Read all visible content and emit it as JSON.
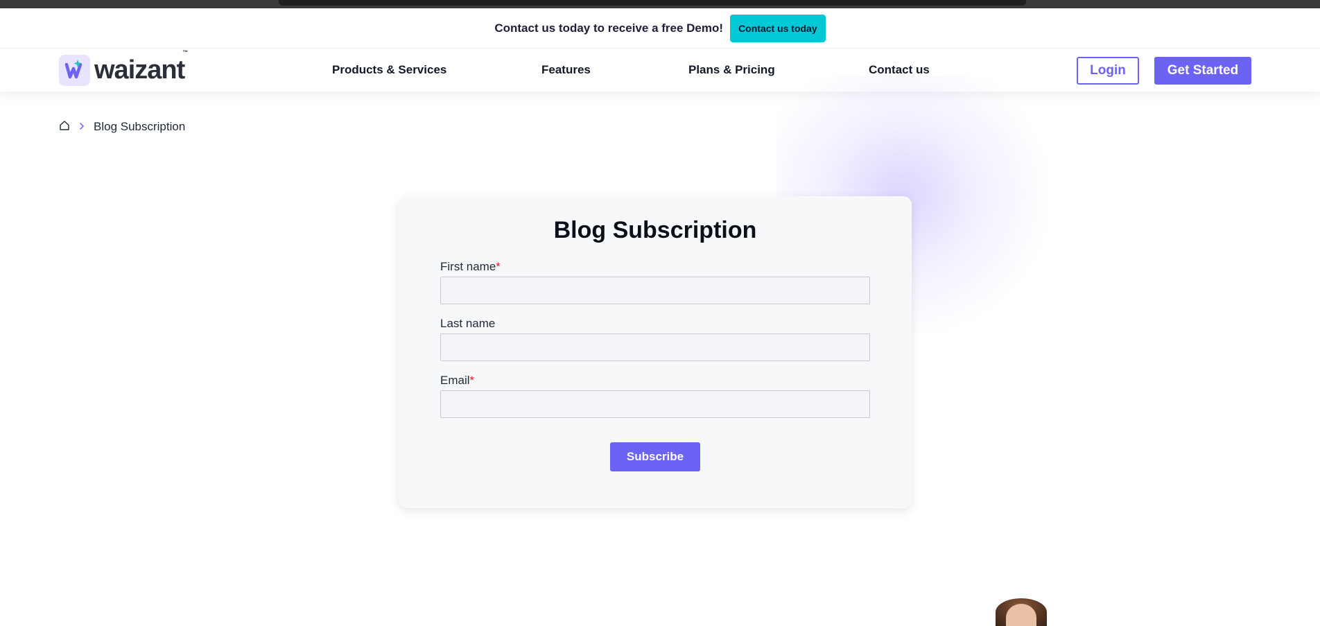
{
  "promo": {
    "text": "Contact us today to receive a free Demo!",
    "button_label": "Contact us today",
    "button_color": "#00c8d7"
  },
  "brand": {
    "name": "waizant",
    "trademark": "™",
    "accent_color": "#6c63f5"
  },
  "nav": {
    "items": [
      {
        "label": "Products & Services"
      },
      {
        "label": "Features"
      },
      {
        "label": "Plans & Pricing"
      },
      {
        "label": "Contact us"
      }
    ],
    "login_label": "Login",
    "get_started_label": "Get Started"
  },
  "breadcrumb": {
    "home_icon": "home-icon",
    "separator_icon": "chevron-right-icon",
    "current": "Blog Subscription"
  },
  "form": {
    "title": "Blog Subscription",
    "fields": [
      {
        "label": "First name",
        "required_mark": "*",
        "value": ""
      },
      {
        "label": "Last name",
        "required_mark": "",
        "value": ""
      },
      {
        "label": "Email",
        "required_mark": "*",
        "value": ""
      }
    ],
    "submit_label": "Subscribe"
  }
}
